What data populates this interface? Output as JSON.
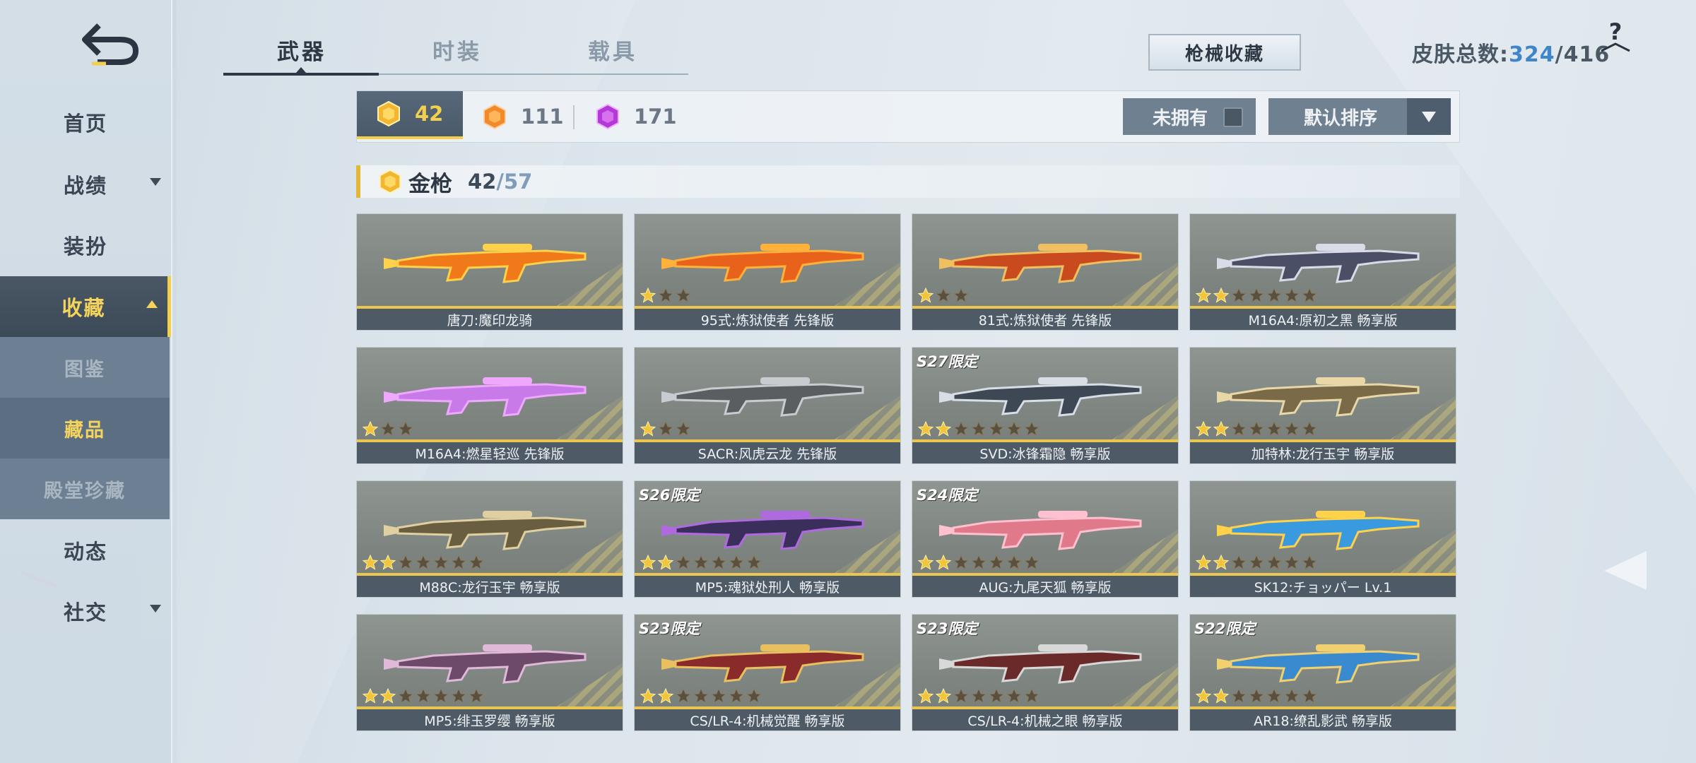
{
  "sidebar": {
    "items": [
      {
        "label": "首页",
        "name": "nav-home"
      },
      {
        "label": "战绩",
        "name": "nav-record"
      },
      {
        "label": "装扮",
        "name": "nav-dressup"
      },
      {
        "label": "收藏",
        "name": "nav-collection"
      },
      {
        "label": "图鉴",
        "name": "subnav-catalog"
      },
      {
        "label": "藏品",
        "name": "subnav-items"
      },
      {
        "label": "殿堂珍藏",
        "name": "subnav-hall"
      },
      {
        "label": "动态",
        "name": "nav-feed"
      },
      {
        "label": "社交",
        "name": "nav-social"
      }
    ]
  },
  "tabs": [
    {
      "label": "武器"
    },
    {
      "label": "时装"
    },
    {
      "label": "载具"
    }
  ],
  "header": {
    "collection_button": "枪械收藏",
    "skin_total_label": "皮肤总数:",
    "skin_total_current": "324",
    "skin_total_sep": "/",
    "skin_total_max": "416",
    "help_label": "?"
  },
  "filter": {
    "gold_count": "42",
    "orange_count": "111",
    "purple_count": "171",
    "not_owned_label": "未拥有",
    "sort_label": "默认排序"
  },
  "section": {
    "title": "金枪",
    "owned": "42",
    "sep": "/",
    "total": "57"
  },
  "colors": {
    "gold": "#f2cf4d",
    "panel_dark": "#4a5866",
    "accent_blue": "#3f86c9"
  },
  "cards": [
    {
      "name": "唐刀:魔印龙骑",
      "stars": 0,
      "badge": ""
    },
    {
      "name": "95式:炼狱使者 先锋版",
      "stars": 3,
      "badge": ""
    },
    {
      "name": "81式:炼狱使者 先锋版",
      "stars": 3,
      "badge": ""
    },
    {
      "name": "M16A4:原初之黑 畅享版",
      "stars": 7,
      "badge": ""
    },
    {
      "name": "M16A4:燃星轻巡 先锋版",
      "stars": 3,
      "badge": ""
    },
    {
      "name": "SACR:风虎云龙 先锋版",
      "stars": 3,
      "badge": ""
    },
    {
      "name": "SVD:冰锋霜隐 畅享版",
      "stars": 7,
      "badge": "S27限定"
    },
    {
      "name": "加特林:龙行玉宇 畅享版",
      "stars": 7,
      "badge": ""
    },
    {
      "name": "M88C:龙行玉宇 畅享版",
      "stars": 7,
      "badge": ""
    },
    {
      "name": "MP5:魂狱处刑人 畅享版",
      "stars": 7,
      "badge": "S26限定"
    },
    {
      "name": "AUG:九尾天狐 畅享版",
      "stars": 7,
      "badge": "S24限定"
    },
    {
      "name": "SK12:チョッパー Lv.1",
      "stars": 7,
      "badge": ""
    },
    {
      "name": "MP5:绯玉罗缨 畅享版",
      "stars": 7,
      "badge": ""
    },
    {
      "name": "CS/LR-4:机械觉醒 畅享版",
      "stars": 7,
      "badge": "S23限定"
    },
    {
      "name": "CS/LR-4:机械之眼 畅享版",
      "stars": 7,
      "badge": "S23限定"
    },
    {
      "name": "AR18:缭乱影武 畅享版",
      "stars": 7,
      "badge": "S22限定"
    }
  ]
}
